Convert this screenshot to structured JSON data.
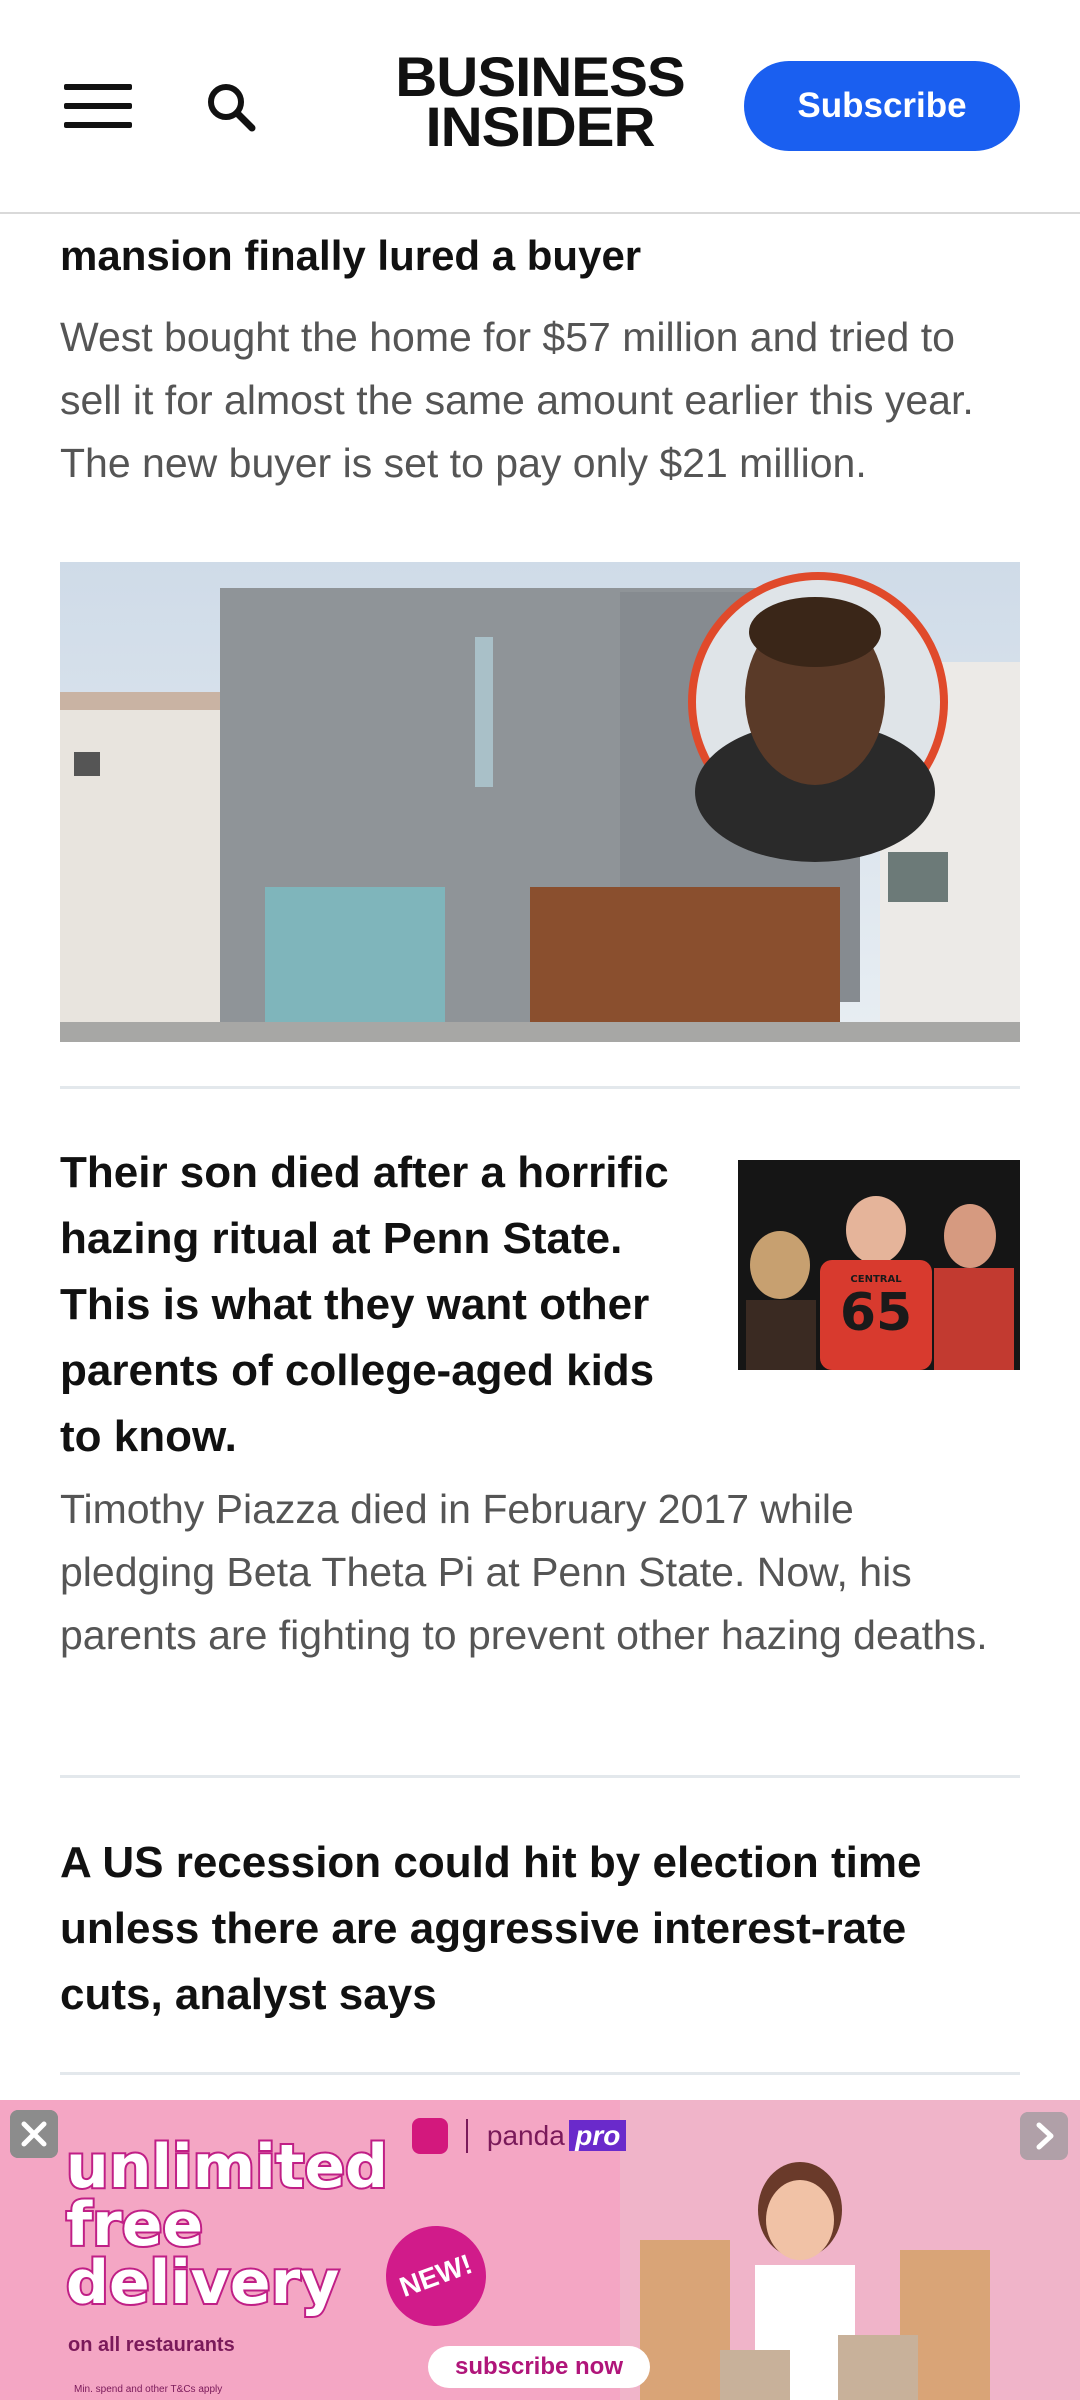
{
  "header": {
    "logo_line1": "BUSINESS",
    "logo_line2": "INSIDER",
    "subscribe_label": "Subscribe"
  },
  "articles": [
    {
      "title_fragment": "mansion finally lured a buyer",
      "summary": "West bought the home for $57 million and tried to sell it for almost the same amount earlier this year. The new buyer is set to pay only $21 million."
    },
    {
      "title": "Their son died after a horrific hazing ritual at Penn State. This is what they want other parents of college-aged kids to know.",
      "summary": "Timothy Piazza died in February 2017 while pledging Beta Theta Pi at Penn State. Now, his parents are fighting to prevent other hazing deaths.",
      "jersey_number": "65",
      "jersey_text": "CENTRAL"
    },
    {
      "title": "A US recession could hit by election time unless there are aggressive interest-rate cuts, analyst says"
    }
  ],
  "ad": {
    "brand": "panda",
    "brand_suffix": "pro",
    "headline": [
      "unlimited",
      "free",
      "delivery"
    ],
    "subline": "on all restaurants",
    "badge": "NEW!",
    "cta": "subscribe now",
    "fine_print": "Min. spend and other T&Cs apply",
    "colors": {
      "background": "#f4a6c4",
      "accent": "#c01f86"
    }
  },
  "icons": [
    "menu-icon",
    "search-icon",
    "close-icon",
    "chevron-right-icon"
  ],
  "colors": {
    "brand_blue": "#1a5ff0",
    "headline": "#111111",
    "body_text": "#555555"
  }
}
